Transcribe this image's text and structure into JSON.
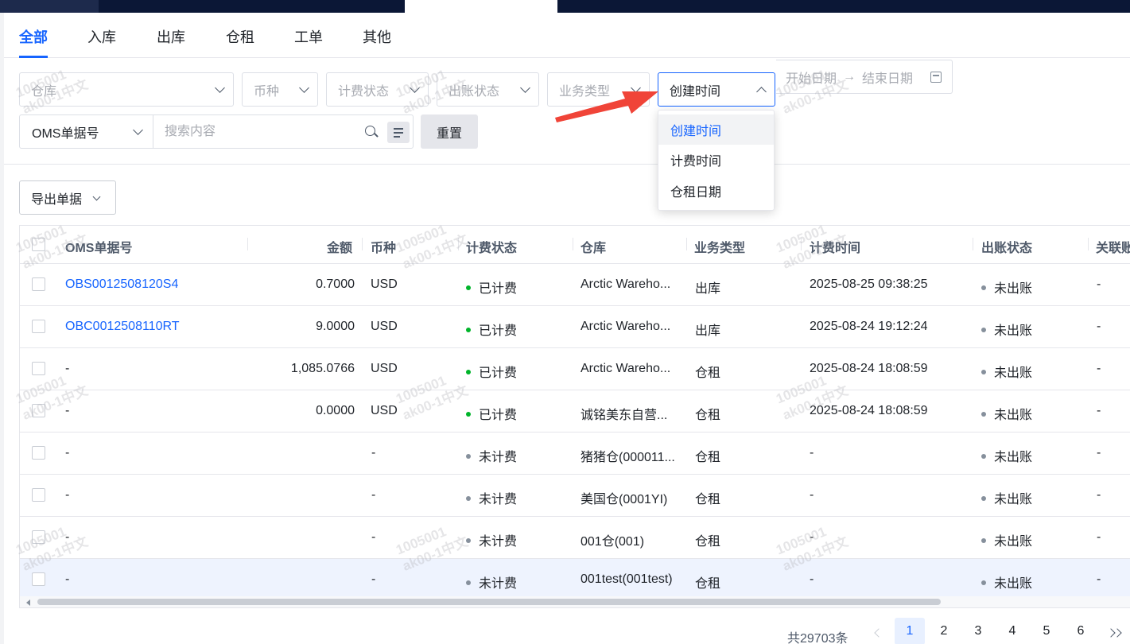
{
  "tabs": [
    "全部",
    "入库",
    "出库",
    "仓租",
    "工单",
    "其他"
  ],
  "filters": {
    "warehouse": "仓库",
    "currency": "币种",
    "billing_status": "计费状态",
    "bill_status": "出账状态",
    "business_type": "业务类型",
    "time_type": "创建时间",
    "start_date": "开始日期",
    "end_date": "结束日期",
    "search_type": "OMS单据号",
    "search_placeholder": "搜索内容",
    "reset": "重置"
  },
  "time_type_options": [
    "创建时间",
    "计费时间",
    "仓租日期"
  ],
  "export_label": "导出单据",
  "columns": [
    "OMS单据号",
    "金额",
    "币种",
    "计费状态",
    "仓库",
    "业务类型",
    "计费时间",
    "出账状态",
    "关联账"
  ],
  "rows": [
    {
      "oms": "OBS0012508120S4",
      "amount": "0.7000",
      "currency": "USD",
      "billing": "已计费",
      "warehouse": "Arctic Wareho...",
      "type": "出库",
      "time": "2025-08-25 09:38:25",
      "bill": "未出账",
      "link": "-"
    },
    {
      "oms": "OBC0012508110RT",
      "amount": "9.0000",
      "currency": "USD",
      "billing": "已计费",
      "warehouse": "Arctic Wareho...",
      "type": "出库",
      "time": "2025-08-24 19:12:24",
      "bill": "未出账",
      "link": "-"
    },
    {
      "oms": "-",
      "amount": "1,085.0766",
      "currency": "USD",
      "billing": "已计费",
      "warehouse": "Arctic Wareho...",
      "type": "仓租",
      "time": "2025-08-24 18:08:59",
      "bill": "未出账",
      "link": "-"
    },
    {
      "oms": "-",
      "amount": "0.0000",
      "currency": "USD",
      "billing": "已计费",
      "warehouse": "诚铭美东自营...",
      "type": "仓租",
      "time": "2025-08-24 18:08:59",
      "bill": "未出账",
      "link": "-"
    },
    {
      "oms": "-",
      "amount": "",
      "currency": "-",
      "billing": "未计费",
      "warehouse": "猪猪仓(000011...",
      "type": "仓租",
      "time": "-",
      "bill": "未出账",
      "link": "-"
    },
    {
      "oms": "-",
      "amount": "",
      "currency": "-",
      "billing": "未计费",
      "warehouse": "美国仓(0001YI)",
      "type": "仓租",
      "time": "-",
      "bill": "未出账",
      "link": "-"
    },
    {
      "oms": "-",
      "amount": "",
      "currency": "-",
      "billing": "未计费",
      "warehouse": "001仓(001)",
      "type": "仓租",
      "time": "-",
      "bill": "未出账",
      "link": "-"
    },
    {
      "oms": "-",
      "amount": "",
      "currency": "-",
      "billing": "未计费",
      "warehouse": "001test(001test)",
      "type": "仓租",
      "time": "-",
      "bill": "未出账",
      "link": "-"
    }
  ],
  "pagination": {
    "total": "共29703条",
    "pages": [
      "1",
      "2",
      "3",
      "4",
      "5",
      "6"
    ],
    "current": "1"
  },
  "watermark": {
    "line1": "1005001",
    "line2": "ak00-1中文"
  },
  "colors": {
    "primary": "#1664ff",
    "billed_dot": "#00b42a",
    "unbilled_dot": "#86909c",
    "annotation_arrow": "#f04438"
  }
}
